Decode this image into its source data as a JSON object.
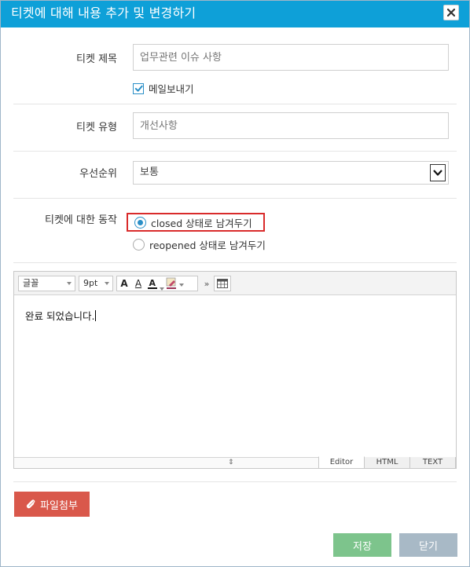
{
  "dialog": {
    "title": "티켓에 대해 내용 추가 및 변경하기"
  },
  "form": {
    "ticket_title": {
      "label": "티켓 제목",
      "placeholder": "업무관련 이슈 사항",
      "send_mail_label": "메일보내기",
      "send_mail_checked": true
    },
    "ticket_type": {
      "label": "티켓 유형",
      "placeholder": "개선사항"
    },
    "priority": {
      "label": "우선순위",
      "selected": "보통"
    },
    "action": {
      "label": "티켓에 대한 동작",
      "options": [
        {
          "label": "closed 상태로 남겨두기",
          "checked": true
        },
        {
          "label": "reopened 상태로 남겨두기",
          "checked": false
        }
      ]
    }
  },
  "editor": {
    "toolbar": {
      "font_family": "글꼴",
      "font_size": "9pt"
    },
    "content": "완료 되었습니다.",
    "modes": [
      "Editor",
      "HTML",
      "TEXT"
    ],
    "active_mode": "Editor"
  },
  "buttons": {
    "attach": "파일첨부",
    "save": "저장",
    "close": "닫기"
  },
  "colors": {
    "titlebar": "#0ea0d8",
    "attach": "#d9584b",
    "save": "#7dc48c",
    "close": "#a8b9c6",
    "highlight": "#d92b2b",
    "accent": "#2a8fc7"
  }
}
